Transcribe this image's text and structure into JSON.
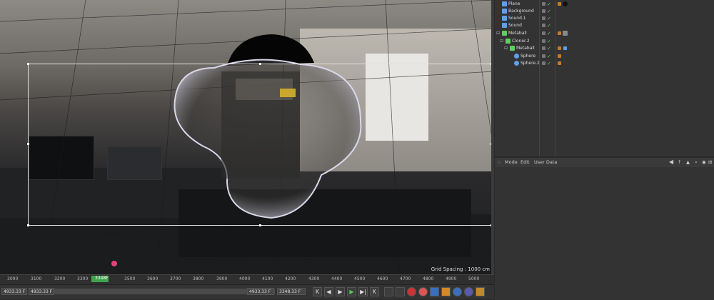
{
  "viewport": {
    "grid_spacing": "Grid Spacing : 1000 cm"
  },
  "timeline": {
    "ticks": [
      "3000",
      "3100",
      "3200",
      "3300",
      "3348F",
      "3500",
      "3600",
      "3700",
      "3800",
      "3900",
      "4000",
      "4100",
      "4200",
      "4300",
      "4400",
      "4500",
      "4600",
      "4700",
      "4800",
      "4900",
      "5000"
    ],
    "current_frame": "3348 F"
  },
  "bottombar": {
    "start_field": "4933.33 F",
    "slider_field": "4933.33 F",
    "end_field": "4933.33 F",
    "right_field": "3348.33 F",
    "transport_icons": [
      "K",
      "◀",
      "▶",
      "▶",
      "▶|",
      "K"
    ]
  },
  "objects": {
    "items": [
      {
        "name": "Plane",
        "indent": 0,
        "color": "#5fa0e8"
      },
      {
        "name": "Background",
        "indent": 0,
        "color": "#5fa0e8"
      },
      {
        "name": "Sound.1",
        "indent": 0,
        "color": "#5fa0e8"
      },
      {
        "name": "Sound",
        "indent": 0,
        "color": "#5fa0e8"
      },
      {
        "name": "Metaball",
        "indent": 0,
        "color": "#5fd05f"
      },
      {
        "name": "Cloner.2",
        "indent": 1,
        "color": "#5fd05f"
      },
      {
        "name": "Metaball",
        "indent": 2,
        "color": "#5fd05f"
      },
      {
        "name": "Sphere",
        "indent": 3,
        "color": "#5fa0e8"
      },
      {
        "name": "Sphere.2",
        "indent": 3,
        "color": "#5fa0e8"
      }
    ]
  },
  "attributes": {
    "menu": [
      "Mode",
      "Edit",
      "User Data"
    ]
  }
}
